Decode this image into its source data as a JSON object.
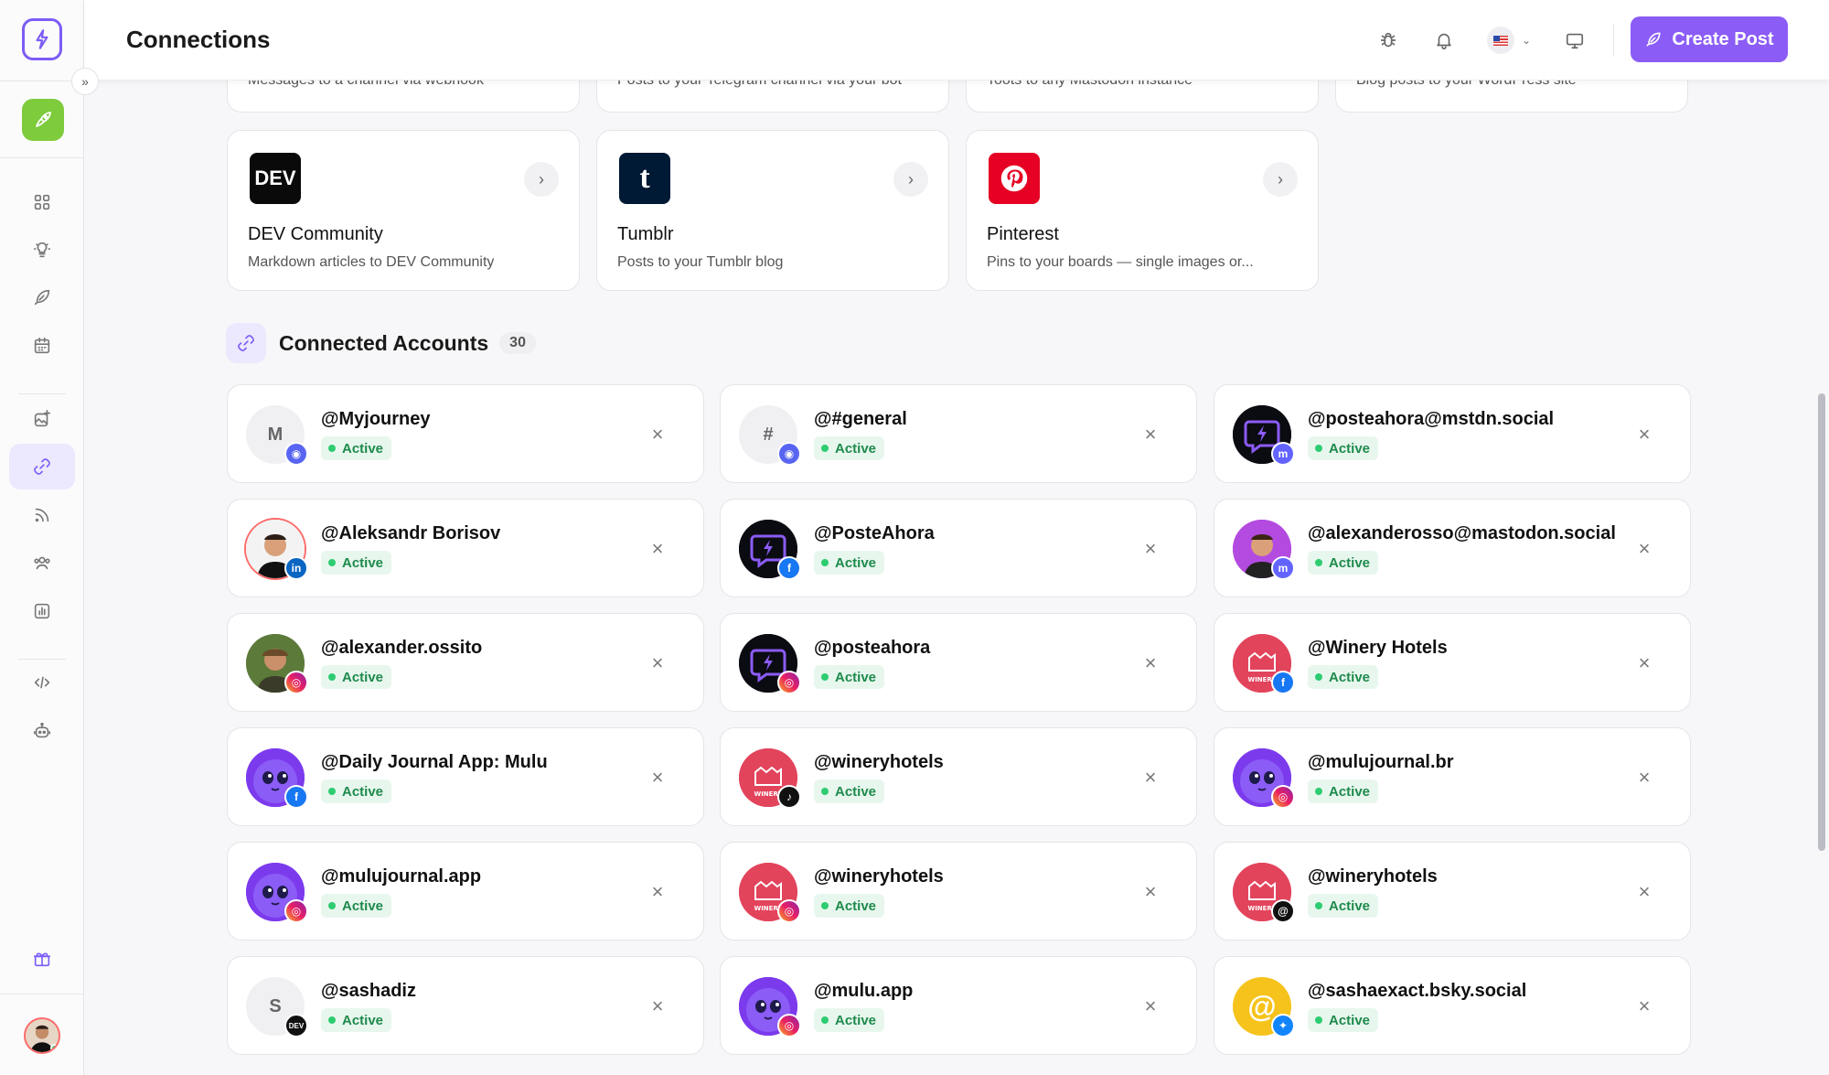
{
  "header": {
    "title": "Connections",
    "create_label": "Create Post"
  },
  "providers_top": [
    {
      "desc": "Messages to a channel via webhook"
    },
    {
      "desc": "Posts to your Telegram channel via your bot"
    },
    {
      "desc": "Toots to any Mastodon instance"
    },
    {
      "desc": "Blog posts to your WordPress site"
    }
  ],
  "providers": [
    {
      "name": "DEV Community",
      "desc": "Markdown articles to DEV Community",
      "logo_text": "DEV",
      "color": "#0a0a0a"
    },
    {
      "name": "Tumblr",
      "desc": "Posts to your Tumblr blog",
      "logo_text": "t",
      "color": "#001935"
    },
    {
      "name": "Pinterest",
      "desc": "Pins to your boards — single images or...",
      "logo_text": "P",
      "color": "#e60023"
    }
  ],
  "accounts_section": {
    "title": "Connected Accounts",
    "count": "30"
  },
  "accounts": [
    {
      "name": "@Myjourney",
      "status": "Active",
      "initial": "M",
      "avatar": "initial",
      "platform": "discord"
    },
    {
      "name": "@#general",
      "status": "Active",
      "initial": "#",
      "avatar": "initial",
      "platform": "discord"
    },
    {
      "name": "@posteahora@mstdn.social",
      "status": "Active",
      "initial": "",
      "avatar": "postea",
      "platform": "mastodon"
    },
    {
      "name": "@Aleksandr Borisov",
      "status": "Active",
      "initial": "",
      "avatar": "person",
      "platform": "linkedin"
    },
    {
      "name": "@PosteAhora",
      "status": "Active",
      "initial": "",
      "avatar": "postea",
      "platform": "facebook"
    },
    {
      "name": "@alexanderosso@mastodon.social",
      "status": "Active",
      "initial": "",
      "avatar": "person-purple",
      "platform": "mastodon"
    },
    {
      "name": "@alexander.ossito",
      "status": "Active",
      "initial": "",
      "avatar": "person-green",
      "platform": "instagram"
    },
    {
      "name": "@posteahora",
      "status": "Active",
      "initial": "",
      "avatar": "postea",
      "platform": "instagram"
    },
    {
      "name": "@Winery Hotels",
      "status": "Active",
      "initial": "",
      "avatar": "winery",
      "platform": "facebook"
    },
    {
      "name": "@Daily Journal App: Mulu",
      "status": "Active",
      "initial": "",
      "avatar": "mulu",
      "platform": "facebook"
    },
    {
      "name": "@wineryhotels",
      "status": "Active",
      "initial": "",
      "avatar": "winery",
      "platform": "tiktok"
    },
    {
      "name": "@mulujournal.br",
      "status": "Active",
      "initial": "",
      "avatar": "mulu",
      "platform": "instagram"
    },
    {
      "name": "@mulujournal.app",
      "status": "Active",
      "initial": "",
      "avatar": "mulu",
      "platform": "instagram"
    },
    {
      "name": "@wineryhotels",
      "status": "Active",
      "initial": "",
      "avatar": "winery",
      "platform": "instagram"
    },
    {
      "name": "@wineryhotels",
      "status": "Active",
      "initial": "",
      "avatar": "winery",
      "platform": "threads"
    },
    {
      "name": "@sashadiz",
      "status": "Active",
      "initial": "S",
      "avatar": "initial",
      "platform": "dev"
    },
    {
      "name": "@mulu.app",
      "status": "Active",
      "initial": "",
      "avatar": "mulu",
      "platform": "instagram"
    },
    {
      "name": "@sashaexact.bsky.social",
      "status": "Active",
      "initial": "",
      "avatar": "at",
      "platform": "bluesky"
    }
  ],
  "colors": {
    "accent": "#8b5cf6",
    "active_green": "#2ecc71",
    "rocket_green": "#7ecb3c"
  }
}
